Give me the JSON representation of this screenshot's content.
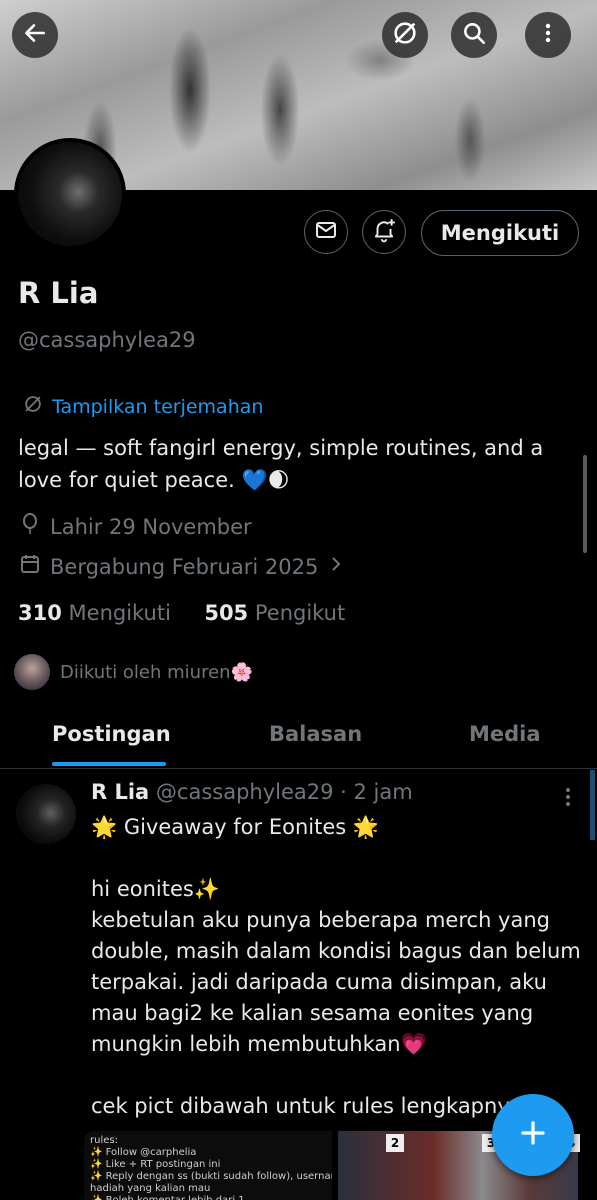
{
  "header": {
    "back_icon": "arrow-left-icon",
    "translate_icon": "translate-slash-icon",
    "search_icon": "search-icon",
    "more_icon": "more-vertical-icon"
  },
  "profile": {
    "name": "R Lia",
    "handle": "@cassaphylea29",
    "translate_link": "Tampilkan terjemahan",
    "bio": "legal — soft fangirl energy, simple routines, and a love for quiet peace. 💙🌒",
    "birthday": "Lahir 29 November",
    "joined": "Bergabung Februari 2025",
    "following_count": "310",
    "following_label": "Mengikuti",
    "followers_count": "505",
    "followers_label": "Pengikut",
    "followed_by": "Diikuti oleh miuren🌸"
  },
  "actions": {
    "follow_label": "Mengikuti",
    "message_icon": "mail-icon",
    "notify_icon": "bell-plus-icon"
  },
  "tabs": [
    {
      "label": "Postingan",
      "active": true
    },
    {
      "label": "Balasan",
      "active": false
    },
    {
      "label": "Media",
      "active": false
    }
  ],
  "post": {
    "name": "R Lia",
    "handle_time": "@cassaphylea29 · 2 jam",
    "body": "🌟 Giveaway for Eonites 🌟\n\nhi eonites✨\nkebetulan aku punya beberapa merch yang double, masih dalam kondisi bagus dan belum terpakai. jadi daripada cuma disimpan, aku mau bagi2 ke kalian sesama eonites yang mungkin lebih membutuhkan💗\n\ncek pict dibawah untuk rules lengkapnya ya",
    "image_text": "rules:\n✨ Follow @carphelia\n✨ Like + RT postingan ini\n✨ Reply dengan ss (bukti sudah follow), username + nomor\nhadiah yang kalian mau\n✨ Boleh komentar lebih dari 1",
    "card_numbers": [
      "2",
      "3",
      "4"
    ]
  },
  "colors": {
    "accent": "#1d9bf0",
    "background": "#000000",
    "muted_text": "#71767b"
  }
}
